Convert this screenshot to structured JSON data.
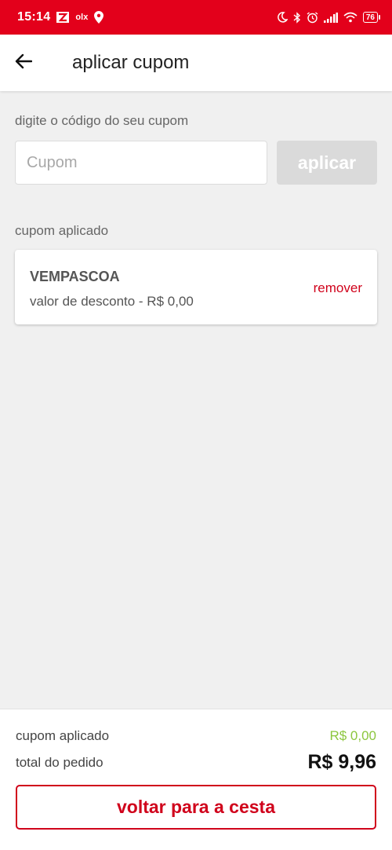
{
  "status_bar": {
    "time": "15:14",
    "left_icons": [
      "notification-app-icon",
      "olx-icon",
      "location-icon"
    ],
    "olx_text": "olx",
    "right_icons": [
      "moon-icon",
      "bluetooth-icon",
      "alarm-icon",
      "signal-icon",
      "wifi-icon"
    ],
    "battery": "76",
    "color": "#e3001b"
  },
  "header": {
    "back_icon": "arrow-left-icon",
    "title": "aplicar cupom"
  },
  "coupon_form": {
    "label": "digite o código do seu cupom",
    "input_placeholder": "Cupom",
    "input_value": "",
    "apply_label": "aplicar"
  },
  "applied_coupon": {
    "section_label": "cupom aplicado",
    "code": "VEMPASCOA",
    "discount_text": "valor de desconto - R$ 0,00",
    "remove_label": "remover"
  },
  "summary": {
    "coupon_label": "cupom aplicado",
    "coupon_value": "R$ 0,00",
    "total_label": "total do pedido",
    "total_value": "R$ 9,96",
    "back_button_label": "voltar para a cesta"
  },
  "colors": {
    "brand_red": "#d0021b",
    "discount_green": "#8cc63e",
    "disabled_gray": "#dadada"
  }
}
